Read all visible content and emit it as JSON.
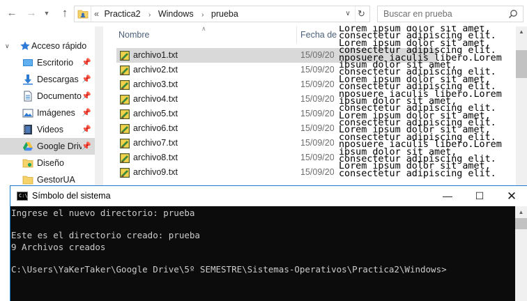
{
  "explorer": {
    "breadcrumb_prefix": "«",
    "breadcrumbs": [
      "Practica2",
      "Windows",
      "prueba"
    ],
    "search_placeholder": "Buscar en prueba",
    "nav": {
      "quick_access": "Acceso rápido",
      "items": [
        {
          "label": "Escritorio",
          "icon": "desktop-icon",
          "pinned": true
        },
        {
          "label": "Descargas",
          "icon": "download-icon",
          "pinned": true
        },
        {
          "label": "Documentos",
          "icon": "documents-icon",
          "pinned": true
        },
        {
          "label": "Imágenes",
          "icon": "pictures-icon",
          "pinned": true
        },
        {
          "label": "Videos",
          "icon": "videos-icon",
          "pinned": true
        },
        {
          "label": "Google Drive",
          "icon": "google-drive-icon",
          "pinned": true
        },
        {
          "label": "Diseño",
          "icon": "folder-icon",
          "pinned": false
        },
        {
          "label": "GestorUA",
          "icon": "folder-icon",
          "pinned": false
        }
      ]
    },
    "columns": {
      "name": "Nombre",
      "date": "Fecha de"
    },
    "files": [
      {
        "name": "archivo1.txt",
        "date": "15/09/20"
      },
      {
        "name": "archivo2.txt",
        "date": "15/09/20"
      },
      {
        "name": "archivo3.txt",
        "date": "15/09/20"
      },
      {
        "name": "archivo4.txt",
        "date": "15/09/20"
      },
      {
        "name": "archivo5.txt",
        "date": "15/09/20"
      },
      {
        "name": "archivo6.txt",
        "date": "15/09/20"
      },
      {
        "name": "archivo7.txt",
        "date": "15/09/20"
      },
      {
        "name": "archivo8.txt",
        "date": "15/09/20"
      },
      {
        "name": "archivo9.txt",
        "date": "15/09/20"
      }
    ],
    "selected_file_index": 0
  },
  "lorem_lines": [
    "Lorem ipsum dolor sit amet,",
    "consectetur adipiscing elit.",
    "Lorem ipsum dolor sit amet,",
    "consectetur adipiscing elit.",
    "nposuere iaculis libero.Lorem",
    "ipsum dolor sit amet,",
    "consectetur adipiscing elit.",
    "Lorem ipsum dolor sit amet,",
    "consectetur adipiscing elit.",
    "nposuere iaculis libero.Lorem",
    "ipsum dolor sit amet,",
    "consectetur adipiscing elit.",
    "Lorem ipsum dolor sit amet,",
    "consectetur adipiscing elit.",
    "Lorem ipsum dolor sit amet,",
    "consectetur adipiscing elit.",
    "nposuere iaculis libero.Lorem",
    "ipsum dolor sit amet,",
    "consectetur adipiscing elit.",
    "Lorem ipsum dolor sit amet,",
    "consectetur adipiscing elit."
  ],
  "console": {
    "title": "Símbolo del sistema",
    "lines": [
      "Ingrese el nuevo directorio: prueba",
      "",
      "Este es el directorio creado: prueba",
      "9 Archivos creados",
      "",
      "C:\\Users\\YaKerTaker\\Google Drive\\5º SEMESTRE\\Sistemas-Operativos\\Practica2\\Windows>"
    ]
  },
  "colors": {
    "accent_blue": "#1979ca",
    "console_bg": "#0c0c0c",
    "console_text": "#cccccc",
    "selection_gray": "#d9d9d9",
    "header_text": "#4c607a"
  }
}
